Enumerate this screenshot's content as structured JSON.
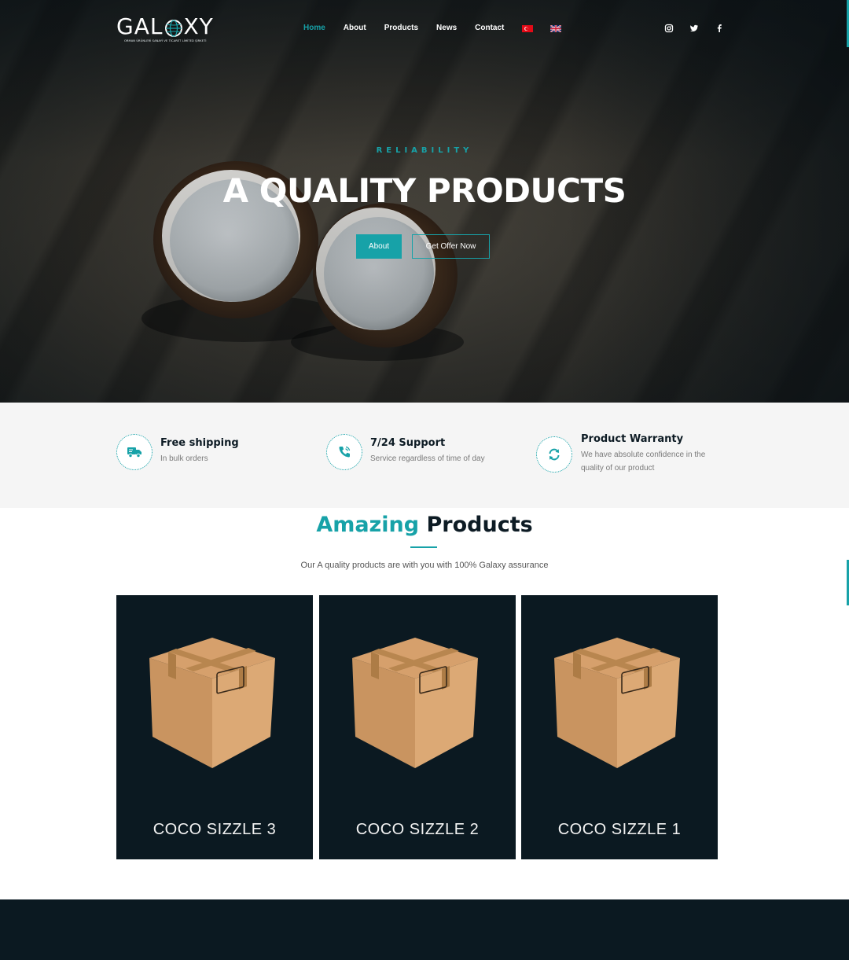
{
  "brand": {
    "name_left": "GAL",
    "name_right": "XY",
    "subtitle": "ORMAN ÜRÜNLERİ SANAYİ VE TİCARET LİMİTED ŞİRKETİ"
  },
  "nav": {
    "items": [
      {
        "label": "Home",
        "active": true
      },
      {
        "label": "About",
        "active": false
      },
      {
        "label": "Products",
        "active": false
      },
      {
        "label": "News",
        "active": false
      },
      {
        "label": "Contact",
        "active": false
      }
    ],
    "flags": [
      "turkey-flag-icon",
      "uk-flag-icon"
    ],
    "social": [
      "instagram-icon",
      "twitter-icon",
      "facebook-icon"
    ]
  },
  "hero": {
    "kicker": "RELIABILITY",
    "title": "A QUALITY PRODUCTS",
    "primary_button": "About",
    "secondary_button": "Get Offer Now"
  },
  "features": [
    {
      "icon": "truck-icon",
      "title": "Free shipping",
      "text": "In bulk orders"
    },
    {
      "icon": "phone-icon",
      "title": "7/24 Support",
      "text": "Service regardless of time of day"
    },
    {
      "icon": "refresh-icon",
      "title": "Product Warranty",
      "text_line1": "We have absolute confidence in the",
      "text_line2": "quality of our product"
    }
  ],
  "products": {
    "title_accent": "Amazing",
    "title_rest": "Products",
    "subtitle": "Our A quality products are with you with 100% Galaxy assurance",
    "items": [
      {
        "name": "COCO SIZZLE 3"
      },
      {
        "name": "COCO SIZZLE 2"
      },
      {
        "name": "COCO SIZZLE 1"
      }
    ]
  },
  "colors": {
    "accent": "#17a2a8",
    "dark": "#0b1921",
    "features_bg": "#f5f5f5"
  }
}
